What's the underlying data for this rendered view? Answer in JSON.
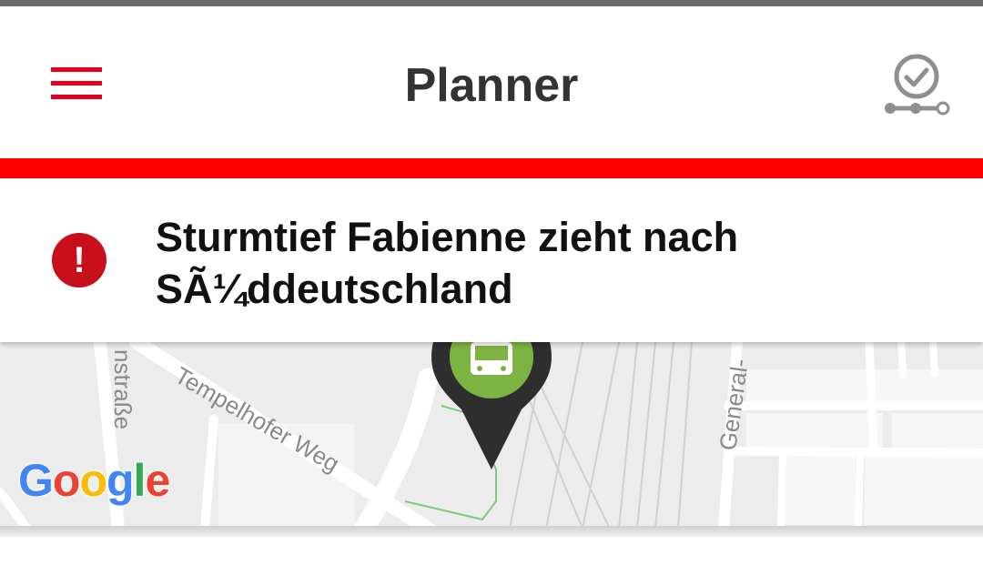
{
  "header": {
    "title": "Planner",
    "menu_icon": "hamburger-menu-icon",
    "trip_icon": "clock-route-icon",
    "accent_color": "#e2001a"
  },
  "alert": {
    "icon": "exclamation-icon",
    "message": "Sturmtief Fabienne zieht nach SÃ¼ddeutschland",
    "icon_color": "#c8101a"
  },
  "map": {
    "streets": [
      "nstraße",
      "Tempelhofer Weg",
      "General-"
    ],
    "marker_icon": "bus-icon",
    "marker_color": "#7cb342",
    "attribution": "Google"
  }
}
